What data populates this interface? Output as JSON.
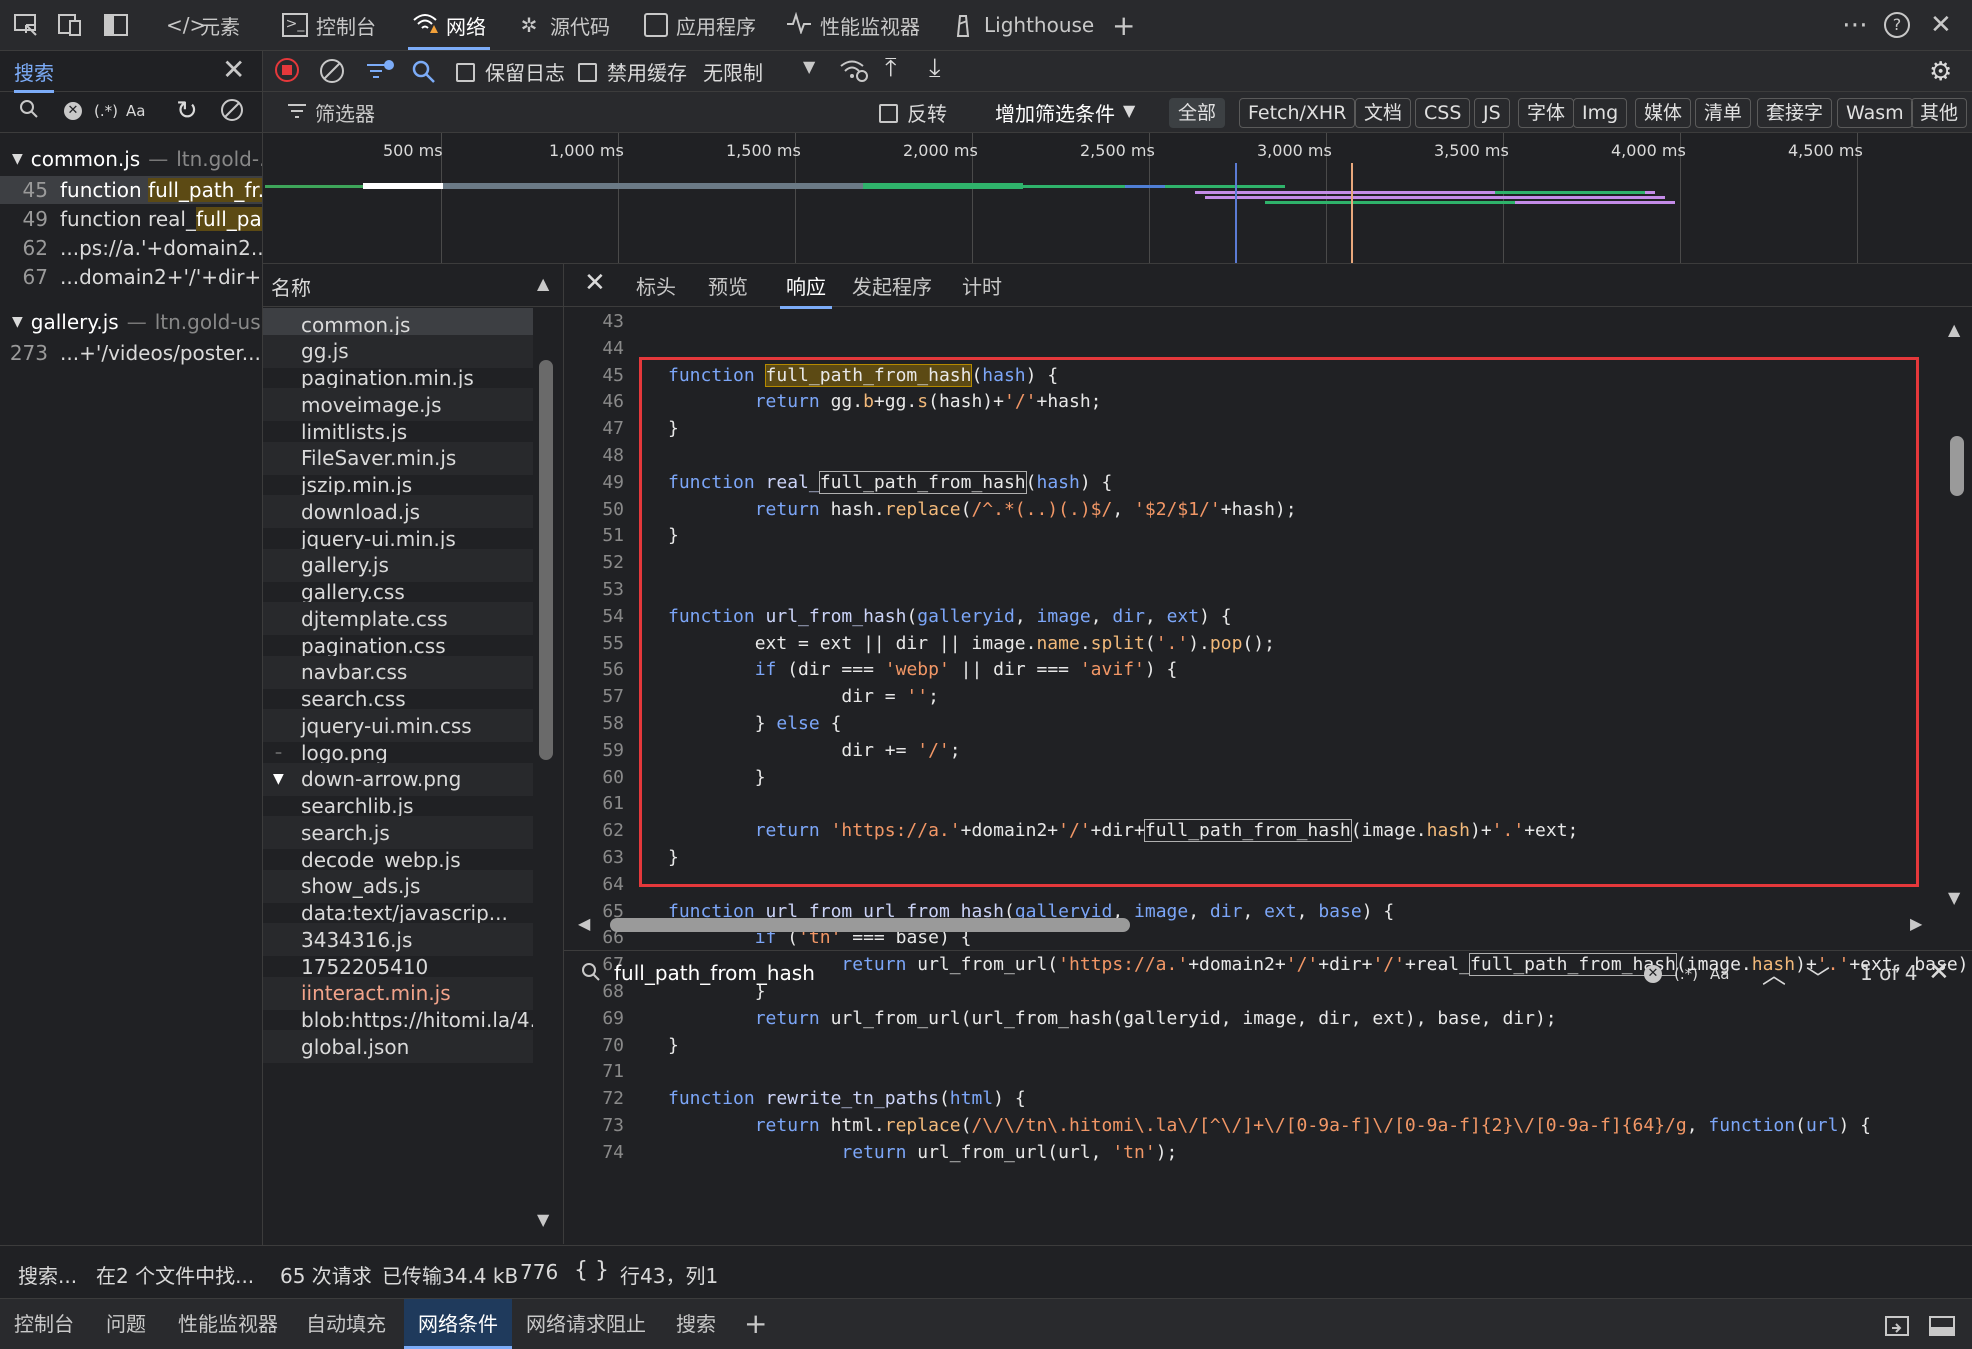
{
  "top_tabs": {
    "elements": "元素",
    "console": "控制台",
    "network": "网络",
    "sources": "源代码",
    "application": "应用程序",
    "performance": "性能监视器",
    "lighthouse": "Lighthouse"
  },
  "search_panel": {
    "tab_label": "搜索",
    "regex_label": "(.*)",
    "case_label": "Aa",
    "results": [
      {
        "file": "common.js",
        "origin": "ltn.gold-...",
        "lines": [
          {
            "num": "45",
            "pre": "function ",
            "match": "full_path_fr...",
            "post": ""
          },
          {
            "num": "49",
            "pre": "function real_",
            "match": "full_pa...",
            "post": ""
          },
          {
            "num": "62",
            "pre": "...ps://a.'+domain2...",
            "match": "",
            "post": ""
          },
          {
            "num": "67",
            "pre": "...domain2+'/'+dir+...",
            "match": "",
            "post": ""
          }
        ]
      },
      {
        "file": "gallery.js",
        "origin": "ltn.gold-us...",
        "lines": [
          {
            "num": "273",
            "pre": "...+'/videos/poster....",
            "match": "",
            "post": ""
          }
        ]
      }
    ],
    "status_left": "搜索...",
    "status_right": "在2 个文件中找..."
  },
  "toolbar": {
    "preserve_log": "保留日志",
    "disable_cache": "禁用缓存",
    "throttle": "无限制"
  },
  "filterbar": {
    "filter_placeholder": "筛选器",
    "invert": "反转",
    "more_filters": "增加筛选条件",
    "chips": [
      "全部",
      "Fetch/XHR",
      "文档",
      "CSS",
      "JS",
      "字体",
      "Img",
      "媒体",
      "清单",
      "套接字",
      "Wasm",
      "其他"
    ]
  },
  "timeline": {
    "ticks": [
      "500 ms",
      "1,000 ms",
      "1,500 ms",
      "2,000 ms",
      "2,500 ms",
      "3,000 ms",
      "3,500 ms",
      "4,000 ms",
      "4,500 ms"
    ]
  },
  "name_list": {
    "header": "名称",
    "items": [
      "common.js",
      "gg.js",
      "pagination.min.js",
      "moveimage.js",
      "limitlists.js",
      "FileSaver.min.js",
      "jszip.min.js",
      "download.js",
      "jquery-ui.min.js",
      "gallery.js",
      "gallery.css",
      "djtemplate.css",
      "pagination.css",
      "navbar.css",
      "search.css",
      "jquery-ui.min.css",
      "logo.png",
      "down-arrow.png",
      "searchlib.js",
      "search.js",
      "decode_webp.js",
      "show_ads.js",
      "data:text/javascrip...",
      "3434316.js",
      "1752205410",
      "iinteract.min.js",
      "blob:https://hitomi.la/4...",
      "global.json"
    ]
  },
  "detail_tabs": [
    "标头",
    "预览",
    "响应",
    "发起程序",
    "计时"
  ],
  "code": {
    "find_query": "full_path_from_hash",
    "find_regex": "(.*)",
    "find_case": "Aa",
    "find_count": "1 of 4",
    "cursor": "行43，列1",
    "braces": "{ }"
  },
  "status": {
    "requests": "65 次请求",
    "transferred": "已传输34.4 kB",
    "size": "776"
  },
  "drawer_tabs": [
    "控制台",
    "问题",
    "性能监视器",
    "自动填充",
    "网络条件",
    "网络请求阻止",
    "搜索"
  ],
  "colors": {
    "accent": "#7cacf8",
    "highlight_box": "#e5383b",
    "keyword": "#7ca6f8",
    "string": "#f29766"
  }
}
